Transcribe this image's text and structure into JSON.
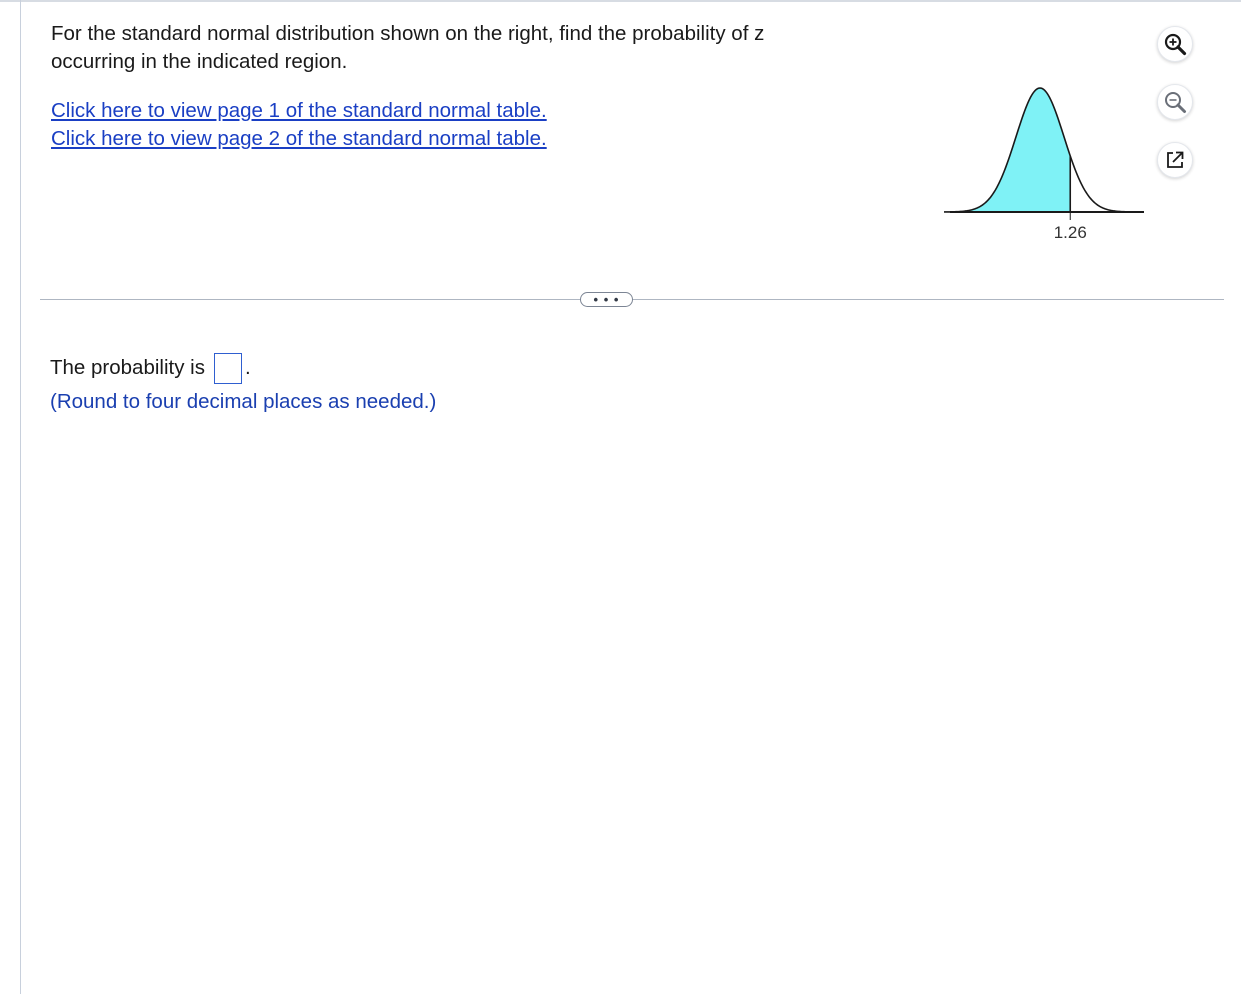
{
  "question": {
    "text": "For the standard normal distribution shown on the right, find the probability of z occurring in the indicated region."
  },
  "links": {
    "page1": "Click here to view page 1 of the standard normal table.",
    "page2": "Click here to view page 2 of the standard normal table."
  },
  "figure": {
    "z_label": "1.26",
    "shaded_region": "left of z",
    "fill_color": "#7ff2f6",
    "curve_color": "#1a1a1a"
  },
  "tools": {
    "zoom_in": "zoom-in-icon",
    "zoom_out": "zoom-out-icon",
    "popout": "popout-icon"
  },
  "divider": {
    "more_label": "• • •"
  },
  "answer": {
    "prefix": "The probability is",
    "suffix": ".",
    "value": "",
    "hint": "(Round to four decimal places as needed.)"
  }
}
